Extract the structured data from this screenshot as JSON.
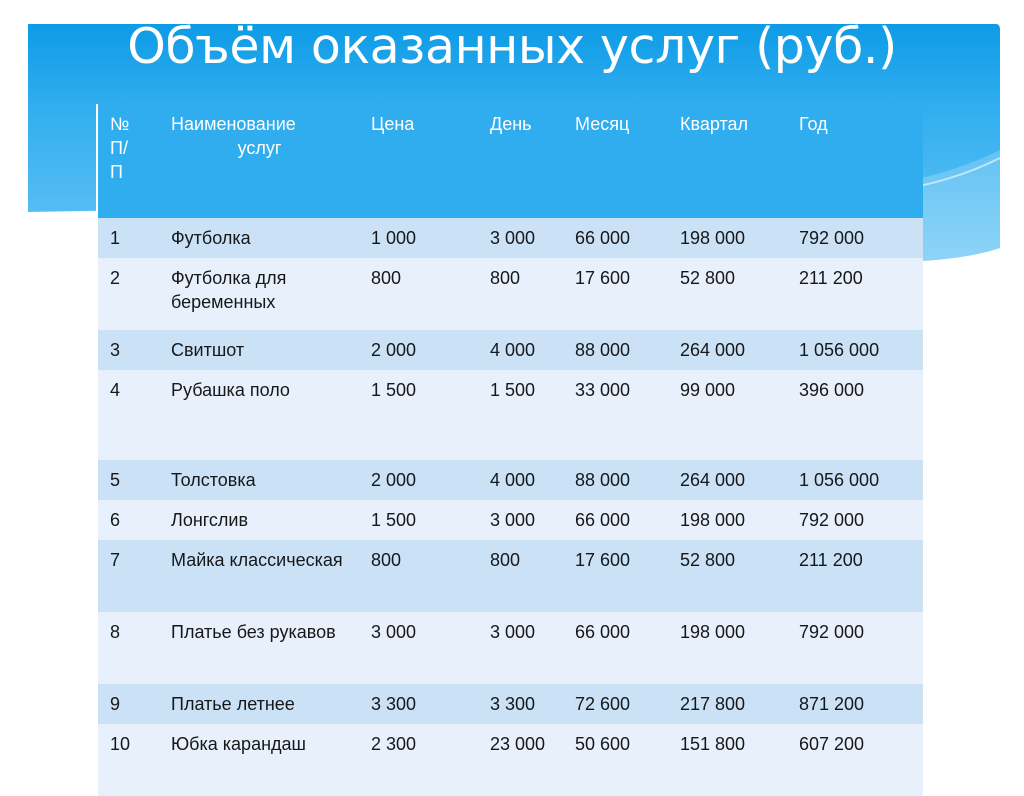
{
  "slide": {
    "title": "Объём оказанных услуг (руб.)",
    "accent_color": "#30ADEE",
    "banner_top_color": "#189FE8",
    "banner_bottom_color": "#7BCBF4",
    "row_odd_color": "#CBE1F6",
    "row_even_color": "#E7F0FB",
    "title_color": "#FFFFFF"
  },
  "table": {
    "headers": {
      "no": "№ П/ П",
      "no_line1": "№",
      "no_line2": "П/",
      "no_line3": "П",
      "name_line1": "Наименование",
      "name_line2": "услуг",
      "price": "Цена",
      "day": "День",
      "month": "Месяц",
      "quarter": "Квартал",
      "year": "Год"
    },
    "rows": [
      {
        "no": "1",
        "name": "Футболка",
        "price": "1 000",
        "day": "3 000",
        "month": "66 000",
        "quarter": "198 000",
        "year": "792 000"
      },
      {
        "no": "2",
        "name": "Футболка для беременных",
        "price": "800",
        "day": "800",
        "month": "17 600",
        "quarter": "52 800",
        "year": "211 200"
      },
      {
        "no": "3",
        "name": "Свитшот",
        "price": "2 000",
        "day": "4 000",
        "month": "88 000",
        "quarter": "264 000",
        "year": "1 056 000"
      },
      {
        "no": "4",
        "name": "Рубашка поло",
        "price": "1 500",
        "day": "1 500",
        "month": "33 000",
        "quarter": "99 000",
        "year": "396 000"
      },
      {
        "no": "5",
        "name": "Толстовка",
        "price": "2 000",
        "day": "4 000",
        "month": "88 000",
        "quarter": "264 000",
        "year": "1 056 000"
      },
      {
        "no": "6",
        "name": "Лонгслив",
        "price": "1 500",
        "day": "3 000",
        "month": "66 000",
        "quarter": "198 000",
        "year": "792 000"
      },
      {
        "no": "7",
        "name": "Майка классическая",
        "price": "800",
        "day": "800",
        "month": "17 600",
        "quarter": "52 800",
        "year": "211 200"
      },
      {
        "no": "8",
        "name": "Платье без рукавов",
        "price": "3 000",
        "day": "3 000",
        "month": "66 000",
        "quarter": "198 000",
        "year": "792 000"
      },
      {
        "no": "9",
        "name": "Платье летнее",
        "price": "3 300",
        "day": "3 300",
        "month": "72 600",
        "quarter": "217 800",
        "year": "871 200"
      },
      {
        "no": "10",
        "name": "Юбка карандаш",
        "price": "2 300",
        "day": "23 000",
        "month": "50 600",
        "quarter": "151 800",
        "year": "607 200"
      }
    ]
  }
}
